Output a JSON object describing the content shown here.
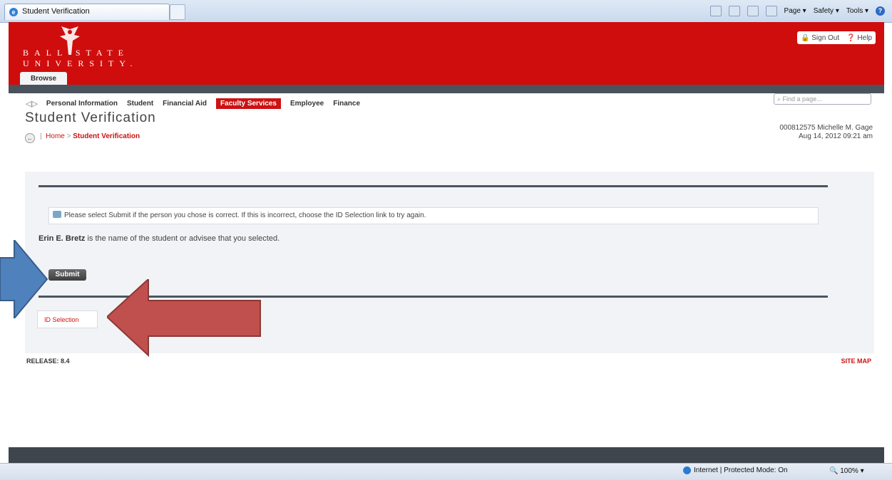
{
  "browser": {
    "tab_title": "Student Verification",
    "cmd": {
      "page": "Page ▾",
      "safety": "Safety ▾",
      "tools": "Tools ▾"
    },
    "status_zone": "Internet | Protected Mode: On",
    "zoom": "100%"
  },
  "header": {
    "logo_line1": "BALL STATE",
    "logo_line2": "UNIVERSITY.",
    "browse_label": "Browse",
    "sign_out": "Sign Out",
    "help": "Help"
  },
  "nav": {
    "items": [
      "Personal Information",
      "Student",
      "Financial Aid",
      "Faculty Services",
      "Employee",
      "Finance"
    ],
    "active_index": 3,
    "find_placeholder": "Find a page..."
  },
  "page": {
    "title": "Student Verification",
    "breadcrumb_home": "Home",
    "breadcrumb_sep": ">",
    "breadcrumb_current": "Student Verification",
    "user_line": "000812575 Michelle M. Gage",
    "date_line": "Aug 14, 2012 09:21 am"
  },
  "content": {
    "info_message": "Please select Submit if the person you chose is correct. If this is incorrect, choose the ID Selection link to try again.",
    "selected_name": "Erin E. Bretz",
    "selected_suffix": " is the name of the student or advisee that you selected.",
    "submit_label": "Submit",
    "id_selection_link": "ID Selection"
  },
  "footer": {
    "release": "RELEASE: 8.4",
    "site_map": "SITE MAP"
  },
  "colors": {
    "brand_red": "#cf0d0d",
    "arrow_blue": "#4f81bd",
    "arrow_red": "#c0504d"
  }
}
